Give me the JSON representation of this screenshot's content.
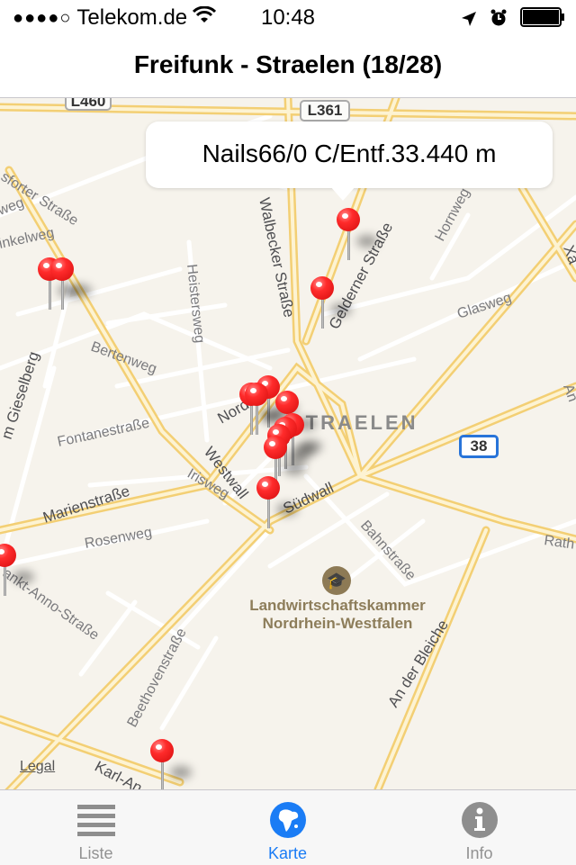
{
  "status_bar": {
    "signal": "●●●●○",
    "carrier": "Telekom.de",
    "time": "10:48",
    "icons": [
      "wifi-icon",
      "location-arrow-icon",
      "alarm-icon",
      "battery-icon"
    ]
  },
  "nav": {
    "title": "Freifunk - Straelen (18/28)"
  },
  "map": {
    "callout": "Nails66/0 C/Entf.33.440 m",
    "road_signs": [
      "L361",
      "L460",
      "38"
    ],
    "city_label": "STRAELEN",
    "poi": {
      "icon": "graduation-cap-icon",
      "name_line1": "Landwirtschaftskammer",
      "name_line2": "Nordrhein-Westfalen"
    },
    "streets": [
      "sforter Straße",
      "weg",
      "inkelweg",
      "Walbecker Straße",
      "Gelderner Straße",
      "Hornweg",
      "Glasweg",
      "Heistersweg",
      "Bertenweg",
      "m Gieselberg",
      "Fontanestraße",
      "Nord",
      "Westwall",
      "Südwall",
      "Marienstraße",
      "Irisweg",
      "Rosenweg",
      "Bahnstraße",
      "ankt-Anno-Straße",
      "Beethovenstraße",
      "An der Bleiche",
      "Karl-An",
      "Rath",
      "Xa",
      "An"
    ],
    "legal": "Legal",
    "pin_count": 14
  },
  "tabbar": {
    "tabs": [
      {
        "label": "Liste",
        "icon": "list-icon",
        "active": false
      },
      {
        "label": "Karte",
        "icon": "globe-icon",
        "active": true
      },
      {
        "label": "Info",
        "icon": "info-icon",
        "active": false
      }
    ]
  },
  "colors": {
    "accent": "#1a7cf5",
    "inactive": "#929292",
    "pin": "#ff2b2b",
    "map_bg": "#f6f3ec",
    "major_road": "#f7d98a"
  }
}
